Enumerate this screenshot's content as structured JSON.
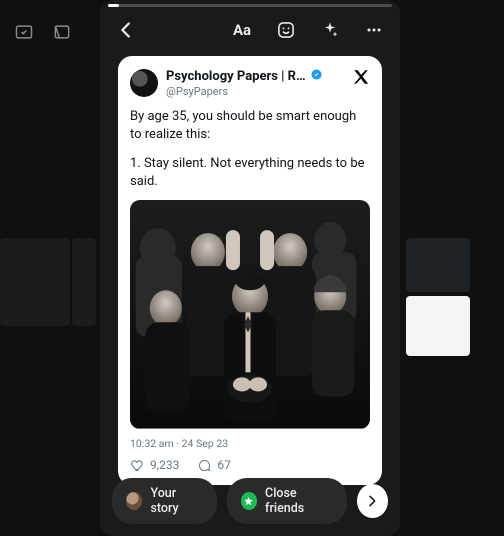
{
  "tweet": {
    "author_name": "Psychology Papers | Resili…",
    "author_handle": "@PsyPapers",
    "body_line1": "By age 35, you should be smart enough to realize this:",
    "body_line2": "1. Stay silent. Not everything needs to be said.",
    "time": "10:32 am",
    "date": "24 Sep 23",
    "likes": "9,233",
    "replies": "67"
  },
  "bottom": {
    "your_story_label": "Your story",
    "close_friends_label": "Close friends"
  },
  "topbar": {
    "aa_label": "Aa"
  },
  "colors": {
    "verified": "#1d9bf0",
    "close_friends_star_bg": "#1db954"
  }
}
